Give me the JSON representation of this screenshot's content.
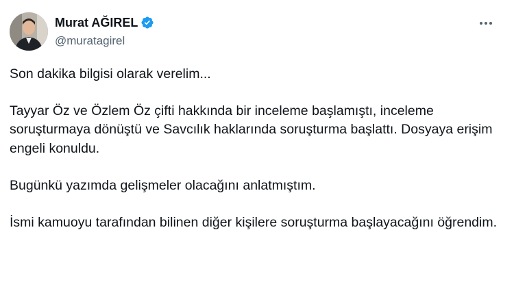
{
  "author": {
    "display_name": "Murat AĞIREL",
    "handle": "@muratagirel",
    "verified_icon": "verified-badge-icon"
  },
  "menu": {
    "icon": "more-options-icon"
  },
  "tweet": {
    "paragraphs": [
      "Son dakika bilgisi olarak verelim...",
      "Tayyar Öz ve Özlem Öz çifti hakkında bir inceleme başlamıştı, inceleme soruşturmaya dönüştü ve Savcılık haklarında soruşturma başlattı. Dosyaya erişim engeli konuldu.",
      "Bugünkü yazımda gelişmeler olacağını anlatmıştım.",
      "İsmi kamuoyu tarafından bilinen diğer kişilere soruşturma başlayacağını öğrendim."
    ]
  },
  "colors": {
    "text": "#0f1419",
    "secondary_text": "#536471",
    "verified_blue": "#1d9bf0",
    "background": "#ffffff"
  }
}
